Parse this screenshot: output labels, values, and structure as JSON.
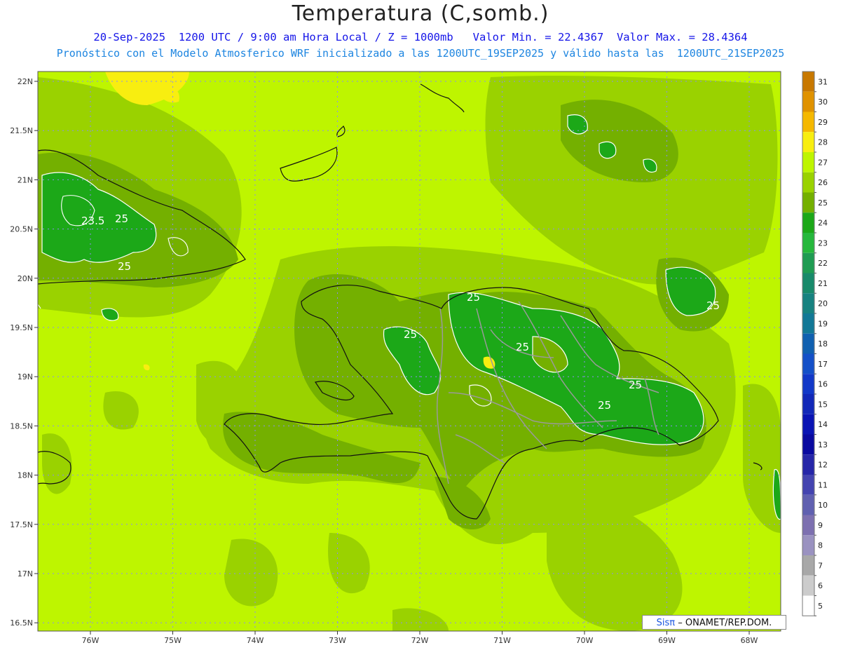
{
  "header": {
    "title": "Temperatura (C,somb.)",
    "line1": "20-Sep-2025  1200 UTC / 9:00 am Hora Local / Z = 1000mb   Valor Min. = 22.4367  Valor Max. = 28.4364",
    "line2": "Pronóstico con el Modelo Atmosferico WRF inicializado a las 1200UTC_19SEP2025 y válido hasta las  1200UTC_21SEP2025"
  },
  "axes": {
    "lat_labels": [
      "22N",
      "21.5N",
      "21N",
      "20.5N",
      "20N",
      "19.5N",
      "19N",
      "18.5N",
      "18N",
      "17.5N",
      "17N",
      "16.5N"
    ],
    "lon_labels": [
      "76W",
      "75W",
      "74W",
      "73W",
      "72W",
      "71W",
      "70W",
      "69W",
      "68W"
    ]
  },
  "colorbar": {
    "labels": [
      "31",
      "30",
      "29",
      "28",
      "27",
      "26",
      "25",
      "24",
      "23",
      "22",
      "21",
      "20",
      "19",
      "18",
      "17",
      "16",
      "15",
      "14",
      "13",
      "12",
      "11",
      "10",
      "9",
      "8",
      "7",
      "6",
      "5"
    ],
    "colors": [
      "#c87800",
      "#e09200",
      "#f5b800",
      "#f8ee10",
      "#bef500",
      "#9ad200",
      "#74b000",
      "#1ca818",
      "#26b83c",
      "#1f9c52",
      "#188a6a",
      "#178280",
      "#127896",
      "#1060b0",
      "#1450c8",
      "#1238c8",
      "#1228b8",
      "#0a14b4",
      "#0a0aa0",
      "#2626a8",
      "#4444b0",
      "#6060b0",
      "#7d70b0",
      "#9a92c0",
      "#a8a8a8",
      "#cccccc",
      "#ffffff"
    ]
  },
  "contour_labels": [
    "23.5",
    "25",
    "25",
    "25",
    "25",
    "25",
    "25",
    "25",
    "25",
    "25"
  ],
  "credit": {
    "logo": "Sisπ",
    "text": "– ONAMET/REP.DOM."
  }
}
